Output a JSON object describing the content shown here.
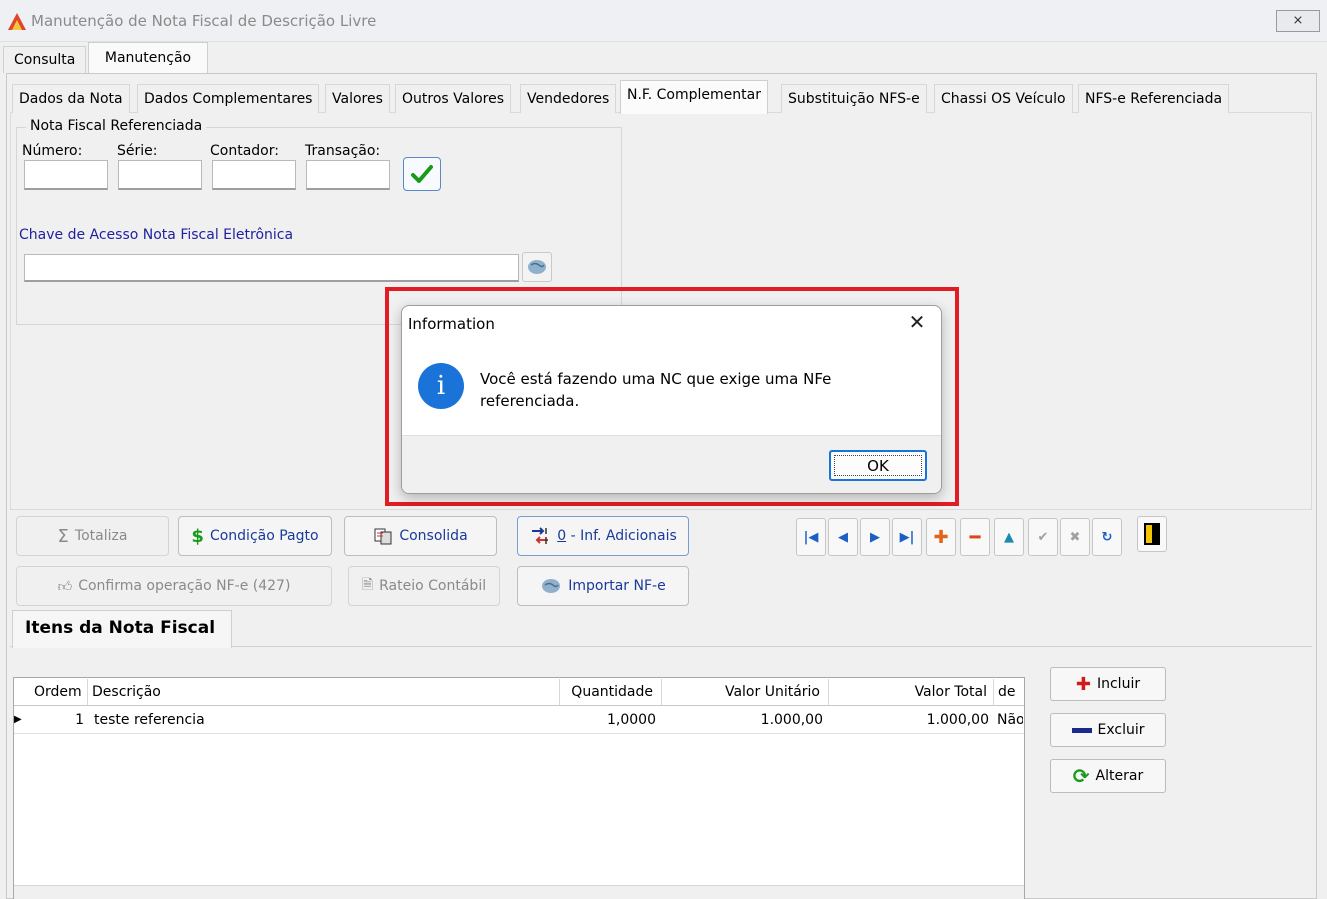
{
  "window": {
    "title": "Manutenção de Nota Fiscal de Descrição Livre",
    "close_label": "⨯"
  },
  "outer_tabs": [
    "Consulta",
    "Manutenção"
  ],
  "inner_tabs": [
    "Dados da Nota",
    "Dados Complementares",
    "Valores",
    "Outros Valores",
    "Vendedores",
    "N.F. Complementar",
    "Substituição NFS-e",
    "Chassi OS Veículo",
    "NFS-e Referenciada"
  ],
  "nf_group": {
    "legend": "Nota Fiscal Referenciada",
    "numero_label": "Número:",
    "serie_label": "Série:",
    "contador_label": "Contador:",
    "transacao_label": "Transação:",
    "chave_label": "Chave de Acesso Nota Fiscal Eletrônica"
  },
  "toolbar": {
    "totaliza": "Totaliza",
    "condicao_pagto": "Condição Pagto",
    "consolida": "Consolida",
    "inf_adicionais_prefix": "0",
    "inf_adicionais": " - Inf. Adicionais",
    "confirma_operacao": "Confirma operação NF-e (427)",
    "rateio_contabil": "Rateio Contábil",
    "importar_nfe": "Importar NF-e"
  },
  "items": {
    "tab_label": "Itens da Nota Fiscal",
    "headers": [
      "Ordem",
      "Descrição",
      "Quantidade",
      "Valor Unitário",
      "Valor Total",
      "de"
    ],
    "rows": [
      {
        "ordem": "1",
        "descricao": "teste referencia",
        "quantidade": "1,0000",
        "valor_unitario": "1.000,00",
        "valor_total": "1.000,00",
        "de": "Não"
      }
    ],
    "incluir": "Incluir",
    "excluir": "Excluir",
    "alterar": "Alterar"
  },
  "dialog": {
    "title": "Information",
    "message": "Você está fazendo uma NC que exige uma NFe referenciada.",
    "ok": "OK"
  },
  "colors": {
    "highlight": "#e01c24",
    "info_blue": "#1a73d8"
  }
}
